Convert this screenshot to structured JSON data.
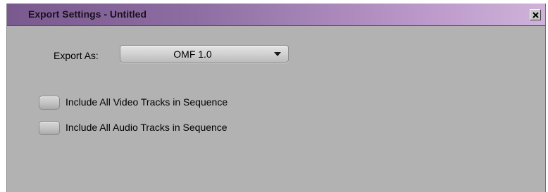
{
  "window": {
    "title": "Export Settings - Untitled",
    "close_glyph": "close-icon"
  },
  "export": {
    "label": "Export As:",
    "selected": "OMF 1.0",
    "arrow_icon": "chevron-down-icon"
  },
  "options": [
    {
      "label": "Include All Video Tracks in Sequence",
      "checked": false
    },
    {
      "label": "Include All Audio Tracks in Sequence",
      "checked": false
    }
  ],
  "colors": {
    "titlebar_start": "#7a5a8e",
    "titlebar_end": "#cfb2da",
    "window_bg": "#b2b2b2"
  }
}
